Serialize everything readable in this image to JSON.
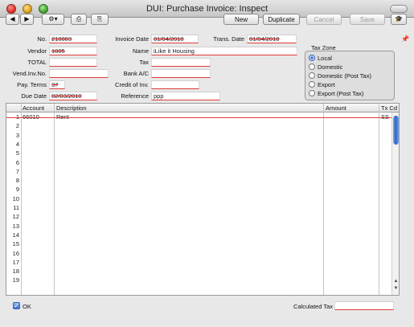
{
  "window": {
    "title": "DUI: Purchase Invoice: Inspect"
  },
  "toolbar": {
    "prev_glyph": "◀",
    "next_glyph": "▶",
    "gear_glyph": "⚙▾",
    "print_glyph": "⎙",
    "preview_glyph": "⎘",
    "new_label": "New",
    "duplicate_label": "Duplicate",
    "cancel_label": "Cancel",
    "save_label": "Save",
    "mortarboard_glyph": "🎓"
  },
  "form": {
    "no_label": "No.",
    "no_value": "210003",
    "invoice_date_label": "Invoice Date",
    "invoice_date_value": "01/04/2010",
    "trans_date_label": "Trans. Date",
    "trans_date_value": "01/04/2010",
    "vendor_label": "Vendor",
    "vendor_value": "1005",
    "name_label": "Name",
    "name_value": "iLike it Housing",
    "total_label": "TOTAL",
    "total_value": "",
    "tax_label": "Tax",
    "tax_value": "",
    "vend_inv_label": "Vend.Inv.No.",
    "vend_inv_value": "",
    "bank_label": "Bank A/C",
    "bank_value": "",
    "pay_terms_label": "Pay. Terms",
    "pay_terms_value": "37",
    "credit_label": "Credit of Inv.",
    "credit_value": "",
    "due_date_label": "Due Date",
    "due_date_value": "02/03/2010",
    "reference_label": "Reference",
    "reference_value": "ppp"
  },
  "tax_zone": {
    "title": "Tax Zone",
    "options": [
      "Local",
      "Domestic",
      "Domestic (Post Tax)",
      "Export",
      "Export (Post Tax)"
    ],
    "selected": "Local"
  },
  "grid": {
    "headers": {
      "account": "Account",
      "description": "Description",
      "amount": "Amount",
      "tax_code": "Tx Cd"
    },
    "rows": [
      {
        "num": "1",
        "account": "66010",
        "description": "Rent",
        "amount": "",
        "tax_code": "SS"
      },
      {
        "num": "2"
      },
      {
        "num": "3"
      },
      {
        "num": "4"
      },
      {
        "num": "5"
      },
      {
        "num": "6"
      },
      {
        "num": "7"
      },
      {
        "num": "8"
      },
      {
        "num": "9"
      },
      {
        "num": "10"
      },
      {
        "num": "11"
      },
      {
        "num": "12"
      },
      {
        "num": "13"
      },
      {
        "num": "14"
      },
      {
        "num": "15"
      },
      {
        "num": "16"
      },
      {
        "num": "17"
      },
      {
        "num": "18"
      },
      {
        "num": "19"
      }
    ]
  },
  "footer": {
    "ok_label": "OK",
    "calculated_tax_label": "Calculated Tax",
    "calculated_tax_value": ""
  }
}
